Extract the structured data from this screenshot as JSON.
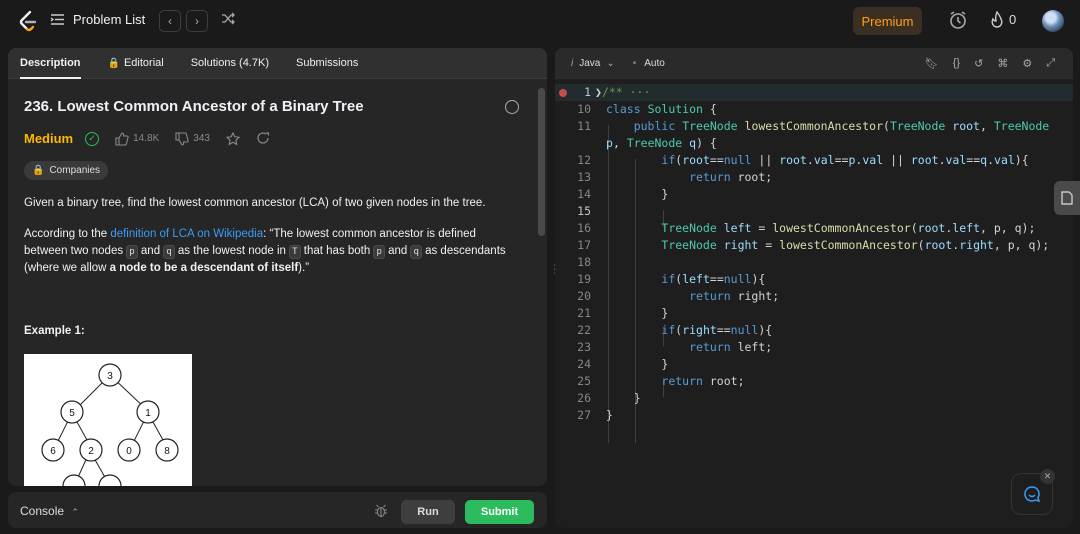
{
  "header": {
    "problem_list": "Problem List",
    "premium": "Premium",
    "streak": "0"
  },
  "tabs": [
    {
      "label": "Description"
    },
    {
      "label": "Editorial"
    },
    {
      "label": "Solutions (4.7K)"
    },
    {
      "label": "Submissions"
    }
  ],
  "problem": {
    "title": "236. Lowest Common Ancestor of a Binary Tree",
    "difficulty": "Medium",
    "likes": "14.8K",
    "dislikes": "343",
    "companies": "Companies",
    "para1": "Given a binary tree, find the lowest common ancestor (LCA) of two given nodes in the tree.",
    "para2_prefix": "According to the ",
    "para2_link": "definition of LCA on Wikipedia",
    "para2_a": ": “The lowest common ancestor is defined between two nodes ",
    "code_p": "p",
    "and1": " and ",
    "code_q": "q",
    "para2_b": " as the lowest node in ",
    "code_T": "T",
    "para2_c": " that has both ",
    "and2": " and ",
    "para2_d": " as descendants (where we allow ",
    "para2_bold": "a node to be a descendant of itself",
    "para2_end": ").”",
    "example": "Example 1:",
    "tree_nodes": [
      "3",
      "5",
      "1",
      "6",
      "2",
      "0",
      "8"
    ]
  },
  "bottom": {
    "console": "Console",
    "run": "Run",
    "submit": "Submit"
  },
  "editor": {
    "language": "Java",
    "mode": "Auto"
  }
}
